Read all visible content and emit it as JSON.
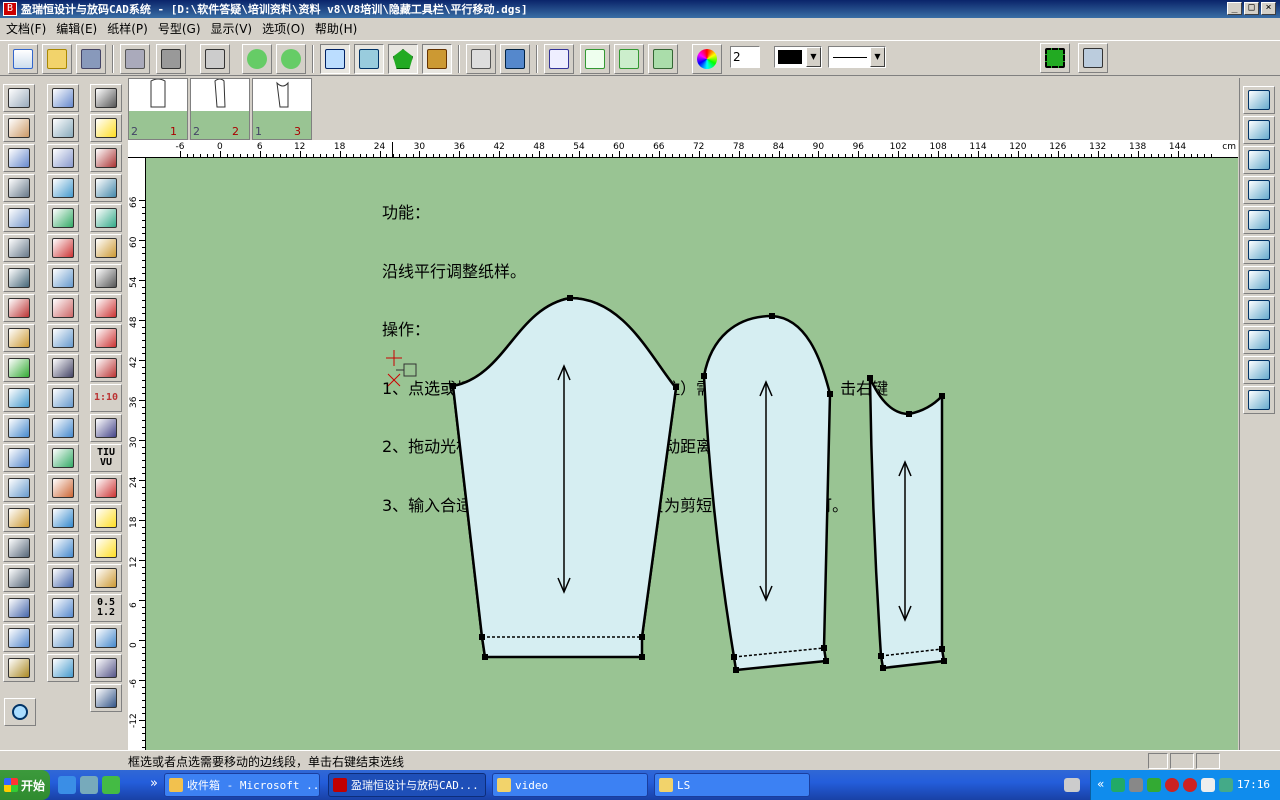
{
  "window": {
    "title": "盈瑞恒设计与放码CAD系统 - [D:\\软件答疑\\培训资料\\资料 v8\\V8培训\\隐藏工具栏\\平行移动.dgs]",
    "app_icon": "B",
    "minimize": "_",
    "restore": "□",
    "close": "×"
  },
  "menu": [
    "文档(F)",
    "编辑(E)",
    "纸样(P)",
    "号型(G)",
    "显示(V)",
    "选项(O)",
    "帮助(H)"
  ],
  "toolbar": {
    "line_width_value": "2",
    "color_swatch": "#000000",
    "line_style_arrow": "▼",
    "color_arrow": "▼"
  },
  "thumbnails": [
    {
      "left_num": "2",
      "right_num": "1"
    },
    {
      "left_num": "2",
      "right_num": "2"
    },
    {
      "left_num": "1",
      "right_num": "3"
    }
  ],
  "ruler": {
    "top_labels": [
      "-6",
      "0",
      "6",
      "12",
      "18",
      "24",
      "30",
      "36",
      "42",
      "48",
      "54",
      "60",
      "66",
      "72",
      "78",
      "84",
      "90",
      "96",
      "102",
      "108",
      "114",
      "120",
      "126",
      "132",
      "138",
      "144"
    ],
    "unit": "cm",
    "left_labels": [
      "66",
      "60",
      "54",
      "48",
      "42",
      "36",
      "30",
      "24",
      "18",
      "12",
      "6",
      "0",
      "-6",
      "-12",
      "-18"
    ]
  },
  "help": {
    "lines": [
      "功能：",
      "沿线平行调整纸样。",
      "操作：",
      "1、点选或框选（框选时线两端点必须框住）需要平行调整的线，击右键",
      "2、拖动光标后单击左键，弹出【平行移动距离】对话框",
      "3、输入合适的数值（输正为加长，输负为剪短），点击确定即可。"
    ]
  },
  "tools": {
    "scale_label": "1:10",
    "tiu_label": "TIU\nVU",
    "grade_label_top": "0.5",
    "grade_label_bottom": "1.2"
  },
  "status": {
    "text": "框选或者点选需要移动的边线段，单击右键结束选线"
  },
  "taskbar": {
    "start": "开始",
    "expand": "»",
    "tasks": [
      {
        "label": "收件箱 - Microsoft ...",
        "icon_color": "#f2c14e"
      },
      {
        "label": "盈瑞恒设计与放码CAD...",
        "icon_color": "#c00000"
      },
      {
        "label": "video",
        "icon_color": "#f2d36b"
      },
      {
        "label": "LS",
        "icon_color": "#f2d36b"
      }
    ],
    "tray_expand": "«",
    "clock": "17:16"
  },
  "colors": {
    "canvas": "#99c493",
    "piece_fill": "#d6eef2",
    "taskbar": "#245edb"
  }
}
